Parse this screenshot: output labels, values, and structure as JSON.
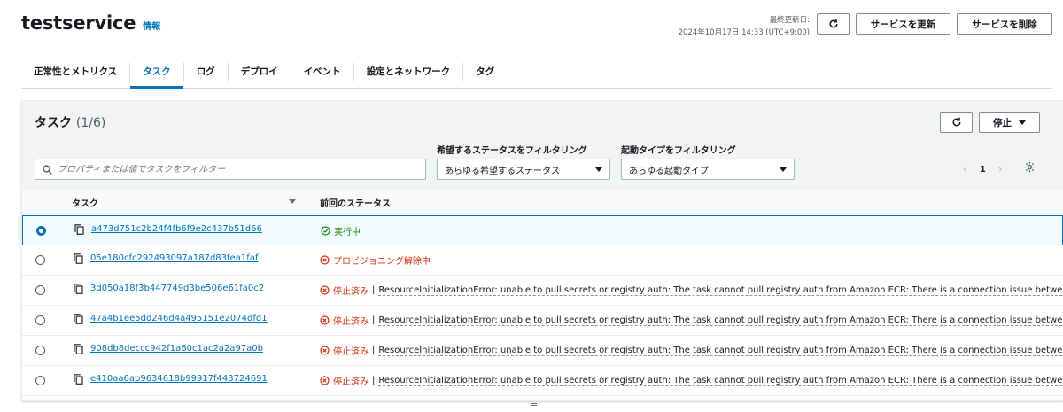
{
  "header": {
    "title": "testservice",
    "info_link": "情報",
    "last_updated_label": "最終更新日:",
    "last_updated_value": "2024年10月17日 14:33 (UTC+9:00)",
    "update_button": "サービスを更新",
    "delete_button": "サービスを削除"
  },
  "tabs": [
    {
      "label": "正常性とメトリクス"
    },
    {
      "label": "タスク"
    },
    {
      "label": "ログ"
    },
    {
      "label": "デプロイ"
    },
    {
      "label": "イベント"
    },
    {
      "label": "設定とネットワーク"
    },
    {
      "label": "タグ"
    }
  ],
  "active_tab": "タスク",
  "tasks_panel": {
    "title": "タスク",
    "count": "(1/6)",
    "stop_button": "停止",
    "filter_placeholder": "プロパティまたは値でタスクをフィルター",
    "desired_status_label": "希望するステータスをフィルタリング",
    "desired_status_value": "あらゆる希望するステータス",
    "launch_type_label": "起動タイプをフィルタリング",
    "launch_type_value": "あらゆる起動タイプ",
    "page_number": "1",
    "columns": {
      "task": "タスク",
      "last_status": "前回のステータス"
    },
    "rows": [
      {
        "id": "a473d751c2b24f4fb6f9e2c437b51d66",
        "status": "実行中",
        "status_type": "ok",
        "message": "",
        "selected": true
      },
      {
        "id": "05e180cfc292493097a187d83fea1faf",
        "status": "プロビジョニング解除中",
        "status_type": "bad",
        "message": "",
        "selected": false
      },
      {
        "id": "3d050a18f3b447749d3be506e61fa0c2",
        "status": "停止済み",
        "status_type": "bad",
        "message": "ResourceInitializationError: unable to pull secrets or registry auth: The task cannot pull registry auth from Amazon ECR: There is a connection issue between t",
        "selected": false
      },
      {
        "id": "47a4b1ee5dd246d4a495151e2074dfd1",
        "status": "停止済み",
        "status_type": "bad",
        "message": "ResourceInitializationError: unable to pull secrets or registry auth: The task cannot pull registry auth from Amazon ECR: There is a connection issue between t",
        "selected": false
      },
      {
        "id": "908db8deccc942f1a60c1ac2a2a97a0b",
        "status": "停止済み",
        "status_type": "bad",
        "message": "ResourceInitializationError: unable to pull secrets or registry auth: The task cannot pull registry auth from Amazon ECR: There is a connection issue between t",
        "selected": false
      },
      {
        "id": "e410aa6ab9634618b99917f443724691",
        "status": "停止済み",
        "status_type": "bad",
        "message": "ResourceInitializationError: unable to pull secrets or registry auth: The task cannot pull registry auth from Amazon ECR: There is a connection issue between t",
        "selected": false
      }
    ]
  },
  "colors": {
    "link": "#0073bb",
    "success": "#1d8102",
    "error": "#d13212"
  },
  "icons": [
    "refresh-icon",
    "search-icon",
    "chevron-left-icon",
    "chevron-right-icon",
    "gear-icon",
    "copy-icon",
    "check-circle-icon",
    "error-circle-icon",
    "sort-icon",
    "resize-handle-icon"
  ],
  "resize_handle": "="
}
